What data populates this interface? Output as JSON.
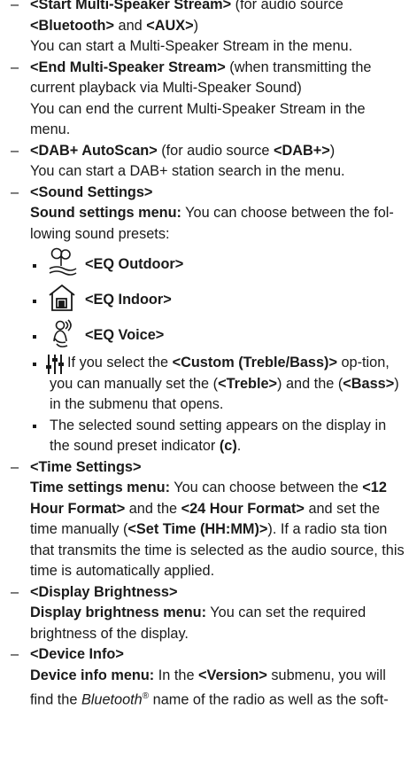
{
  "items": {
    "start_stream": {
      "title": "<Start Multi-Speaker Stream>",
      "note_pre": " (for audio source ",
      "bt": "<Bluetooth>",
      "and": " and ",
      "aux": "<AUX>",
      "close": ")",
      "desc": "You can start a Multi-Speaker Stream in the menu."
    },
    "end_stream": {
      "title": "<End Multi-Speaker Stream>",
      "note": " (when transmitting the current playback via Multi-Speaker Sound)",
      "desc": "You can end the current Multi-Speaker Stream in the menu."
    },
    "dab": {
      "title": "<DAB+ AutoScan>",
      "note_pre": " (for audio source ",
      "src": "<DAB+>",
      "close": ")",
      "desc": "You can start a DAB+ station search in the menu."
    },
    "sound": {
      "title": "<Sound Settings>",
      "menu_label": "Sound settings menu:",
      "menu_desc": " You can choose between the fol-lowing sound presets:",
      "presets": [
        "<EQ Outdoor>",
        "<EQ Indoor>",
        "<EQ Voice>"
      ],
      "custom_pre": "If you select the ",
      "custom_opt": "<Custom (Treble/Bass)>",
      "custom_mid": " op-tion, you can manually set the (",
      "treble": "<Treble>",
      "custom_and": ") and the (",
      "bass": "<Bass>",
      "custom_end": ") in the submenu that opens.",
      "indicator_pre": "The selected sound setting appears on the display in the sound preset indicator ",
      "indicator_ref": "(c)",
      "indicator_end": "."
    },
    "time": {
      "title": "<Time Settings>",
      "menu_label": "Time settings menu:",
      "t1": " You can choose between the ",
      "h12": "<12 Hour Format>",
      "t2": " and the ",
      "h24": "<24 Hour Format>",
      "t3": " and set the time manually (",
      "set": "<Set Time (HH:MM)>",
      "t4": "). If a radio sta tion that transmits the time is selected as the audio source, this time is automatically applied."
    },
    "brightness": {
      "title": "<Display Brightness>",
      "menu_label": "Display brightness menu:",
      "desc": " You can set the required brightness of the display."
    },
    "device": {
      "title": "<Device Info>",
      "menu_label": "Device info menu:",
      "t1": " In the ",
      "version": "<Version>",
      "t2": " submenu, you will find the ",
      "bt_name": "Bluetooth",
      "reg": "®",
      "t3": " name of the radio as well as the soft-"
    }
  },
  "icons": {
    "outdoor": "eq-outdoor-icon",
    "indoor": "eq-indoor-icon",
    "voice": "eq-voice-icon",
    "custom": "eq-custom-icon"
  }
}
